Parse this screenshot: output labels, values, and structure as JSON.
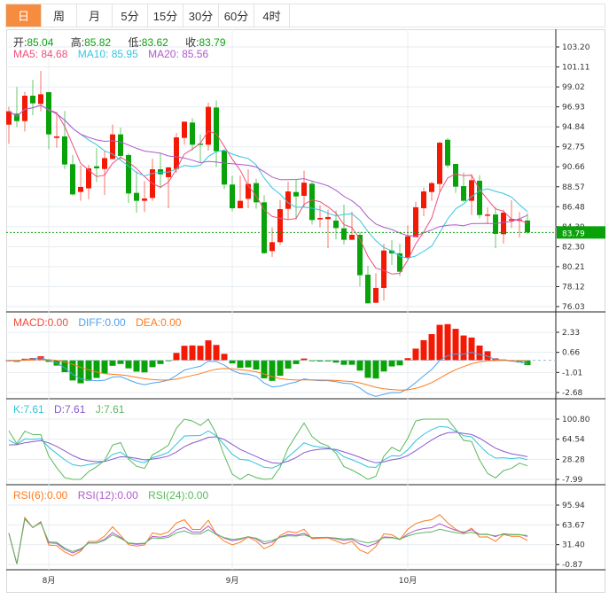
{
  "tabs": [
    {
      "label": "日",
      "active": true
    },
    {
      "label": "周"
    },
    {
      "label": "月"
    },
    {
      "label": "5分"
    },
    {
      "label": "15分"
    },
    {
      "label": "30分"
    },
    {
      "label": "60分"
    },
    {
      "label": "4时"
    }
  ],
  "ohlc": {
    "open_label": "开:",
    "open": "85.04",
    "high_label": "高:",
    "high": "85.82",
    "low_label": "低:",
    "low": "83.62",
    "close_label": "收:",
    "close": "83.79"
  },
  "ma": {
    "ma5": "MA5: 84.68",
    "ma10": "MA10: 85.95",
    "ma20": "MA20: 85.56"
  },
  "macd": {
    "macd": "MACD:0.00",
    "diff": "DIFF:0.00",
    "dea": "DEA:0.00"
  },
  "kdj": {
    "k": "K:7.61",
    "d": "D:7.61",
    "j": "J:7.61"
  },
  "rsi": {
    "rsi6": "RSI(6):0.00",
    "rsi12": "RSI(12):0.00",
    "rsi24": "RSI(24):0.00"
  },
  "current_price": "83.79",
  "colors": {
    "up": "#f31a05",
    "down": "#0aa20a",
    "ma5": "#ef4f7c",
    "ma10": "#36c5e0",
    "ma20": "#b05acc",
    "diff": "#4ea3ef",
    "dea": "#ff7a1a",
    "k": "#2fc3dc",
    "d": "#8a5ad0",
    "j": "#5cb85c",
    "rsi6": "#ff7a1a",
    "rsi12": "#b05acc",
    "rsi24": "#5cb85c",
    "tab_active": "#f58c40"
  },
  "chart_data": {
    "type": "candlestick",
    "price_ticks": [
      "103.20",
      "101.11",
      "99.02",
      "96.93",
      "94.84",
      "92.75",
      "90.66",
      "88.57",
      "86.48",
      "84.39",
      "82.30",
      "80.21",
      "78.12",
      "76.03"
    ],
    "price_range": [
      76.03,
      103.2
    ],
    "macd_ticks": [
      "2.33",
      "0.66",
      "-1.01",
      "-2.68"
    ],
    "kdj_ticks": [
      "100.80",
      "64.54",
      "28.28",
      "-7.99"
    ],
    "rsi_ticks": [
      "95.94",
      "63.67",
      "31.40",
      "-0.87"
    ],
    "x_labels": [
      {
        "label": "8月",
        "index": 5
      },
      {
        "label": "9月",
        "index": 28
      },
      {
        "label": "10月",
        "index": 50
      }
    ],
    "candles": [
      [
        95.07,
        96.93,
        93.06,
        96.47
      ],
      [
        96.22,
        99.0,
        94.82,
        95.44
      ],
      [
        95.44,
        98.5,
        94.36,
        98.1
      ],
      [
        98.1,
        99.77,
        96.06,
        97.3
      ],
      [
        97.24,
        100.7,
        96.47,
        98.25
      ],
      [
        98.47,
        98.47,
        92.5,
        94.05
      ],
      [
        93.68,
        96.37,
        92.66,
        93.84
      ],
      [
        93.84,
        96.5,
        90.43,
        90.9
      ],
      [
        90.93,
        91.9,
        87.65,
        87.77
      ],
      [
        88.03,
        90.8,
        87.1,
        88.55
      ],
      [
        88.4,
        90.87,
        87.25,
        90.5
      ],
      [
        90.71,
        92.6,
        89.07,
        90.5
      ],
      [
        90.43,
        92.35,
        87.71,
        91.57
      ],
      [
        91.48,
        95.07,
        91.42,
        94.05
      ],
      [
        94.05,
        94.76,
        91.42,
        91.8
      ],
      [
        91.89,
        92.1,
        86.88,
        87.87
      ],
      [
        87.93,
        90.19,
        85.86,
        87.1
      ],
      [
        87.1,
        89.17,
        85.92,
        87.34
      ],
      [
        87.4,
        91.5,
        87.1,
        90.4
      ],
      [
        90.4,
        92.04,
        88.4,
        89.88
      ],
      [
        89.57,
        90.65,
        86.32,
        90.59
      ],
      [
        90.43,
        94.2,
        90.03,
        93.74
      ],
      [
        93.68,
        95.38,
        92.97,
        95.38
      ],
      [
        95.29,
        95.75,
        92.35,
        92.97
      ],
      [
        93.09,
        94.05,
        91.11,
        92.97
      ],
      [
        92.97,
        97.36,
        92.35,
        96.93
      ],
      [
        96.86,
        97.6,
        90.65,
        92.29
      ],
      [
        92.35,
        92.5,
        88.33,
        88.8
      ],
      [
        88.8,
        89.72,
        86.0,
        86.32
      ],
      [
        86.32,
        89.72,
        86.32,
        87.1
      ],
      [
        87.31,
        90.4,
        86.32,
        88.86
      ],
      [
        88.95,
        89.41,
        86.26,
        86.94
      ],
      [
        86.94,
        87.7,
        81.52,
        81.62
      ],
      [
        81.84,
        84.31,
        81.22,
        82.77
      ],
      [
        82.77,
        87.16,
        82.46,
        86.23
      ],
      [
        86.26,
        89.1,
        85.18,
        88.08
      ],
      [
        88.02,
        89.32,
        85.09,
        87.56
      ],
      [
        87.62,
        90.25,
        86.48,
        89.0
      ],
      [
        88.89,
        89.1,
        84.62,
        85.09
      ],
      [
        85.15,
        86.63,
        84.32,
        85.3
      ],
      [
        85.18,
        86.17,
        82.15,
        85.4
      ],
      [
        85.03,
        86.08,
        83.08,
        84.25
      ],
      [
        84.22,
        86.69,
        82.52,
        83.02
      ],
      [
        83.02,
        85.98,
        83.02,
        83.54
      ],
      [
        83.54,
        83.85,
        78.13,
        79.31
      ],
      [
        79.37,
        80.3,
        76.37,
        76.37
      ],
      [
        76.43,
        79.52,
        76.43,
        77.98
      ],
      [
        77.98,
        82.6,
        76.65,
        81.9
      ],
      [
        81.9,
        82.99,
        80.39,
        81.6
      ],
      [
        81.6,
        82.6,
        79.22,
        79.68
      ],
      [
        81.13,
        84.53,
        81.13,
        83.39
      ],
      [
        83.3,
        87.0,
        83.3,
        86.42
      ],
      [
        86.32,
        88.49,
        85.49,
        88.08
      ],
      [
        88.02,
        89.1,
        87.1,
        88.95
      ],
      [
        88.86,
        93.28,
        88.02,
        93.18
      ],
      [
        93.49,
        93.68,
        90.56,
        90.8
      ],
      [
        90.96,
        90.96,
        87.93,
        88.58
      ],
      [
        88.64,
        90.09,
        87.03,
        87.1
      ],
      [
        87.1,
        89.88,
        85.61,
        89.26
      ],
      [
        89.2,
        89.78,
        85.24,
        85.61
      ],
      [
        85.55,
        86.39,
        84.69,
        85.67
      ],
      [
        85.67,
        86.42,
        82.15,
        83.64
      ],
      [
        83.6,
        86.17,
        82.62,
        85.86
      ],
      [
        85.03,
        87.16,
        84.25,
        85.18
      ],
      [
        85.0,
        85.92,
        83.24,
        85.15
      ],
      [
        85.04,
        85.82,
        83.62,
        83.79
      ]
    ]
  }
}
